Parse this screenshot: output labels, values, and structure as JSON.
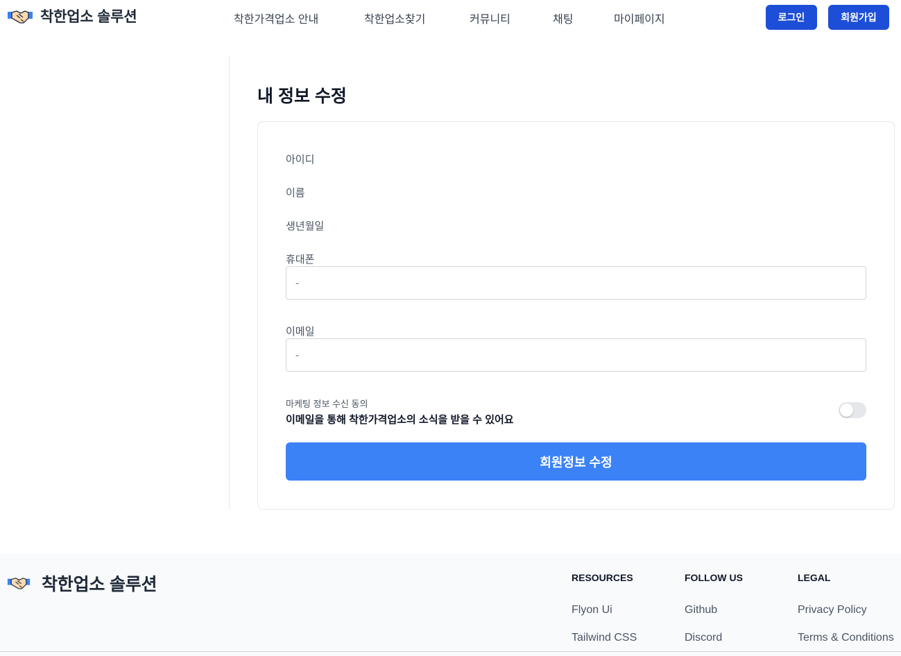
{
  "header": {
    "brand": "착한업소 솔루션",
    "nav": [
      "착한가격업소 안내",
      "착한업소찾기",
      "커뮤니티",
      "채팅",
      "마이페이지"
    ],
    "login_label": "로그인",
    "signup_label": "회원가입"
  },
  "main": {
    "title": "내 정보 수정",
    "fields": {
      "id_label": "아이디",
      "name_label": "이름",
      "birth_label": "생년월일",
      "phone_label": "휴대폰",
      "phone_placeholder": "-",
      "email_label": "이메일",
      "email_placeholder": "-"
    },
    "marketing": {
      "label": "마케팅 정보 수신 동의",
      "description": "이메일을 통해 착한가격업소의 소식을 받을 수 있어요",
      "enabled": false
    },
    "submit_label": "회원정보 수정"
  },
  "footer": {
    "brand": "착한업소 솔루션",
    "columns": [
      {
        "heading": "RESOURCES",
        "links": [
          "Flyon Ui",
          "Tailwind CSS"
        ]
      },
      {
        "heading": "FOLLOW US",
        "links": [
          "Github",
          "Discord"
        ]
      },
      {
        "heading": "LEGAL",
        "links": [
          "Privacy Policy",
          "Terms & Conditions"
        ]
      }
    ]
  },
  "colors": {
    "primary_button": "#1d4ed8",
    "submit_button": "#3b82f6",
    "footer_bg": "#f8fafc"
  },
  "icons": {
    "brand": "handshake-icon"
  }
}
